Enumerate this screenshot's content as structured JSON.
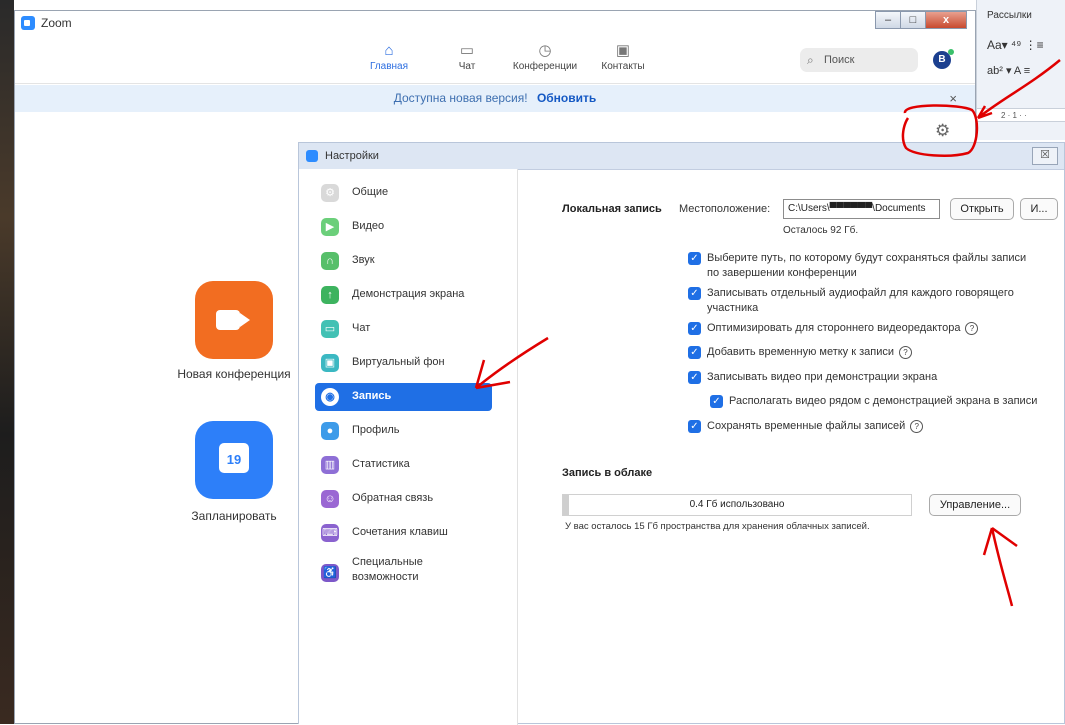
{
  "zoom_window": {
    "title": "Zoom",
    "controls": {
      "minimize": "–",
      "maximize": "□",
      "close": "x"
    },
    "nav": [
      {
        "label": "Главная",
        "icon": "home-icon",
        "glyph": "⌂",
        "active": true
      },
      {
        "label": "Чат",
        "icon": "chat-icon",
        "glyph": "▭",
        "active": false
      },
      {
        "label": "Конференции",
        "icon": "clock-icon",
        "glyph": "◷",
        "active": false
      },
      {
        "label": "Контакты",
        "icon": "contacts-icon",
        "glyph": "▣",
        "active": false
      }
    ],
    "search_placeholder": "Поиск",
    "avatar_letter": "B",
    "update_banner": {
      "text": "Доступна новая версия!",
      "link": "Обновить",
      "close": "×"
    },
    "home_actions": [
      {
        "label": "Новая конференция"
      },
      {
        "label": "Запланировать",
        "calendar_day": "19"
      }
    ]
  },
  "word_strip": {
    "tab": "Рассылки",
    "row1": "Aa▾  ⁴⁹  ⋮≡",
    "row2": "ab² ▾ A  ≡",
    "ruler": "2 · 1 · ·"
  },
  "settings": {
    "title": "Настройки",
    "close": "☒",
    "sidebar": [
      {
        "label": "Общие",
        "icon": "gear-icon",
        "glyph": "⚙",
        "color": "#d9d9d9"
      },
      {
        "label": "Видео",
        "icon": "video-icon",
        "glyph": "▶",
        "color": "#6bcf7a"
      },
      {
        "label": "Звук",
        "icon": "headphones-icon",
        "glyph": "∩",
        "color": "#57bf6a"
      },
      {
        "label": "Демонстрация экрана",
        "icon": "screen-share-icon",
        "glyph": "↑",
        "color": "#3db35f"
      },
      {
        "label": "Чат",
        "icon": "chat-icon",
        "glyph": "▭",
        "color": "#42c1b4"
      },
      {
        "label": "Виртуальный фон",
        "icon": "virtual-background-icon",
        "glyph": "▣",
        "color": "#3bb8c2"
      },
      {
        "label": "Запись",
        "icon": "record-icon",
        "glyph": "◉",
        "color": "#1f6fe5",
        "active": true
      },
      {
        "label": "Профиль",
        "icon": "profile-icon",
        "glyph": "●",
        "color": "#3d9be9"
      },
      {
        "label": "Статистика",
        "icon": "statistics-icon",
        "glyph": "▥",
        "color": "#8e6fd6"
      },
      {
        "label": "Обратная связь",
        "icon": "feedback-icon",
        "glyph": "☺",
        "color": "#9a67d3"
      },
      {
        "label": "Сочетания клавиш",
        "icon": "keyboard-icon",
        "glyph": "⌨",
        "color": "#8a62cf"
      },
      {
        "label": "Специальные возможности",
        "icon": "accessibility-icon",
        "glyph": "♿",
        "color": "#7d58c9"
      }
    ],
    "local_recording": {
      "title": "Локальная запись",
      "location_label": "Местоположение:",
      "path_value": "C:\\Users\\▀▀▀▀▀▀\\Documents",
      "open_button": "Открыть",
      "more_button": "И...",
      "remaining": "Осталось 92 Гб.",
      "options": [
        {
          "text": "Выберите путь, по которому будут сохраняться файлы записи по завершении конференции",
          "help": false,
          "indent": false
        },
        {
          "text": "Записывать отдельный аудиофайл для каждого говорящего участника",
          "help": false,
          "indent": false
        },
        {
          "text": "Оптимизировать для стороннего видеоредактора",
          "help": true,
          "indent": false
        },
        {
          "text": "Добавить временную метку к записи",
          "help": true,
          "indent": false
        },
        {
          "text": "Записывать видео при демонстрации экрана",
          "help": false,
          "indent": false
        },
        {
          "text": "Располагать видео рядом с демонстрацией экрана в записи",
          "help": false,
          "indent": true
        },
        {
          "text": "Сохранять временные файлы записей",
          "help": true,
          "indent": false
        }
      ]
    },
    "cloud_recording": {
      "title": "Запись в облаке",
      "usage_text": "0.4 Гб использовано",
      "usage_fraction": 0.016,
      "manage_button": "Управление...",
      "remaining_text": "У вас осталось 15 Гб пространства для хранения облачных записей."
    }
  },
  "colors": {
    "accent": "#1f6fe5",
    "annotation": "#e00000",
    "new_meeting": "#f26d21",
    "schedule": "#2d7ff9"
  }
}
